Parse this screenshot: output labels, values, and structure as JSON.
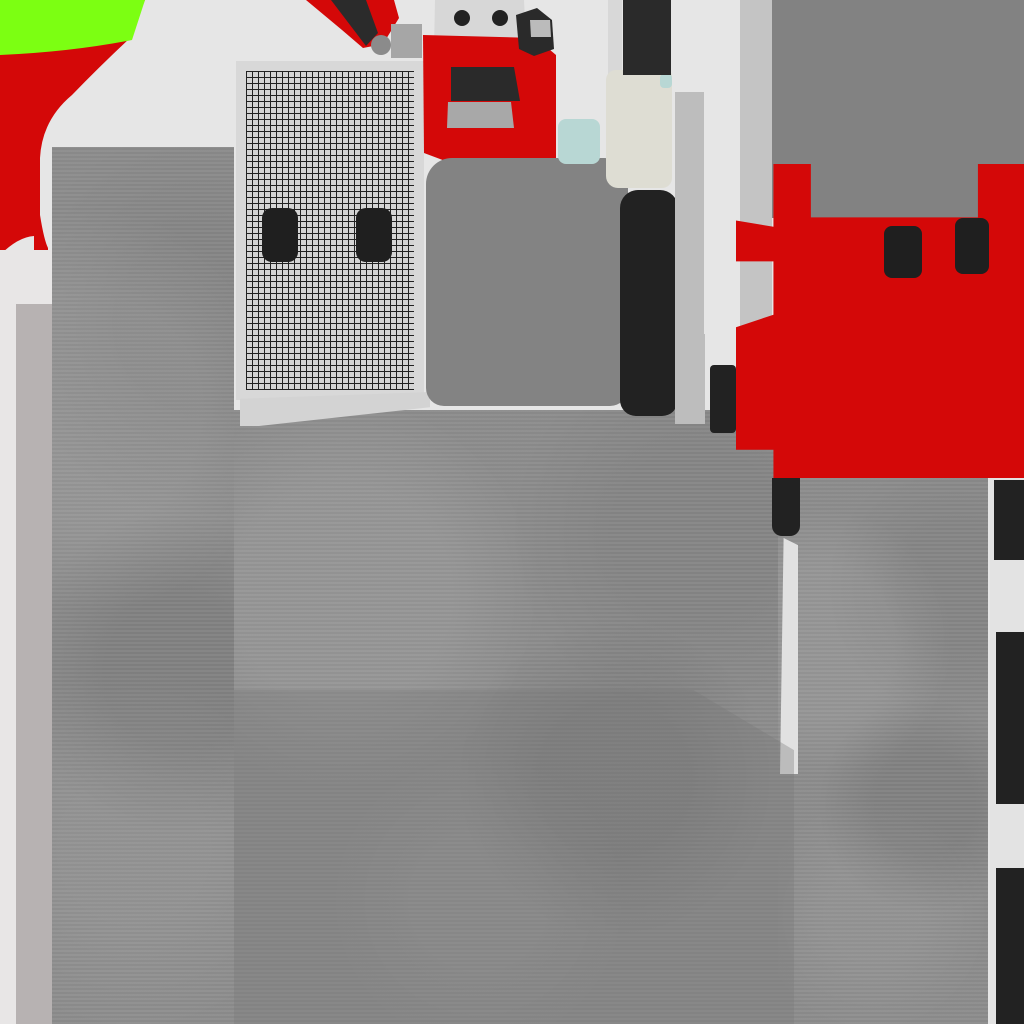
{
  "scene": {
    "colors": {
      "background": "#e6e6e6",
      "red": "#d40808",
      "green": "#7cff12",
      "black": "#2a2a2a",
      "white": "#dcdcdc",
      "panel_gray": "#828282",
      "pale_cream": "#deddd3",
      "pale_cyan": "#b8d7d4"
    },
    "icons": [
      "character-sprite",
      "metal-grille-icon",
      "pipe-icon",
      "red-panel-icon",
      "concrete-floor-icon"
    ]
  }
}
